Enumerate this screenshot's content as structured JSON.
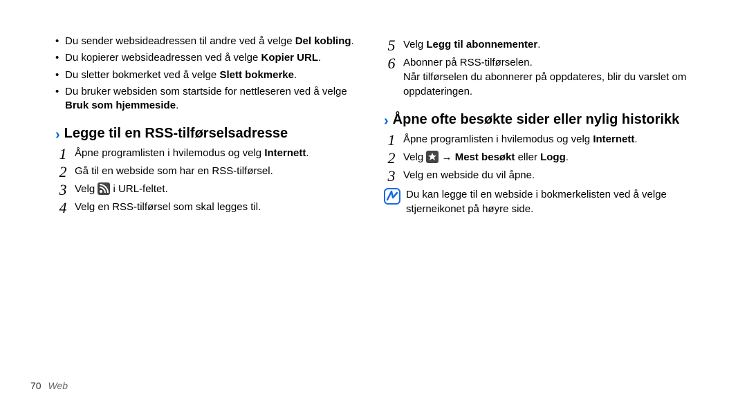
{
  "left": {
    "bullets": [
      {
        "pre": "Du sender websideadressen til andre ved å velge ",
        "bold": "Del kobling",
        "post": "."
      },
      {
        "pre": "Du kopierer websideadressen ved å velge ",
        "bold": "Kopier URL",
        "post": "."
      },
      {
        "pre": "Du sletter bokmerket ved å velge ",
        "bold": "Slett bokmerke",
        "post": "."
      },
      {
        "pre": "Du bruker websiden som startside for nettleseren ved å velge ",
        "bold": "Bruk som hjemmeside",
        "post": "."
      }
    ],
    "section_title": "Legge til en RSS-tilførselsadresse",
    "steps": {
      "s1": {
        "pre": "Åpne programlisten i hvilemodus og velg ",
        "bold": "Internett",
        "post": "."
      },
      "s2": "Gå til en webside som har en RSS-tilførsel.",
      "s3_pre": "Velg ",
      "s3_post": " i URL-feltet.",
      "s4": "Velg en RSS-tilførsel som skal legges til."
    }
  },
  "right": {
    "steps_top": {
      "s5": {
        "pre": "Velg ",
        "bold": "Legg til abonnementer",
        "post": "."
      },
      "s6a": "Abonner på RSS-tilførselen.",
      "s6b": "Når tilførselen du abonnerer på oppdateres, blir du varslet om oppdateringen."
    },
    "section_title": "Åpne ofte besøkte sider eller nylig historikk",
    "steps_main": {
      "s1": {
        "pre": "Åpne programlisten i hvilemodus og velg ",
        "bold": "Internett",
        "post": "."
      },
      "s2_pre": "Velg ",
      "s2_arrow": " → ",
      "s2_bold": "Mest besøkt",
      "s2_mid": " eller ",
      "s2_bold2": "Logg",
      "s2_post": ".",
      "s3": "Velg en webside du vil åpne."
    },
    "note": "Du kan legge til en webside i bokmerkelisten ved å velge stjerneikonet på høyre side."
  },
  "footer": {
    "page": "70",
    "section": "Web"
  },
  "nums": {
    "n1": "1",
    "n2": "2",
    "n3": "3",
    "n4": "4",
    "n5": "5",
    "n6": "6"
  }
}
